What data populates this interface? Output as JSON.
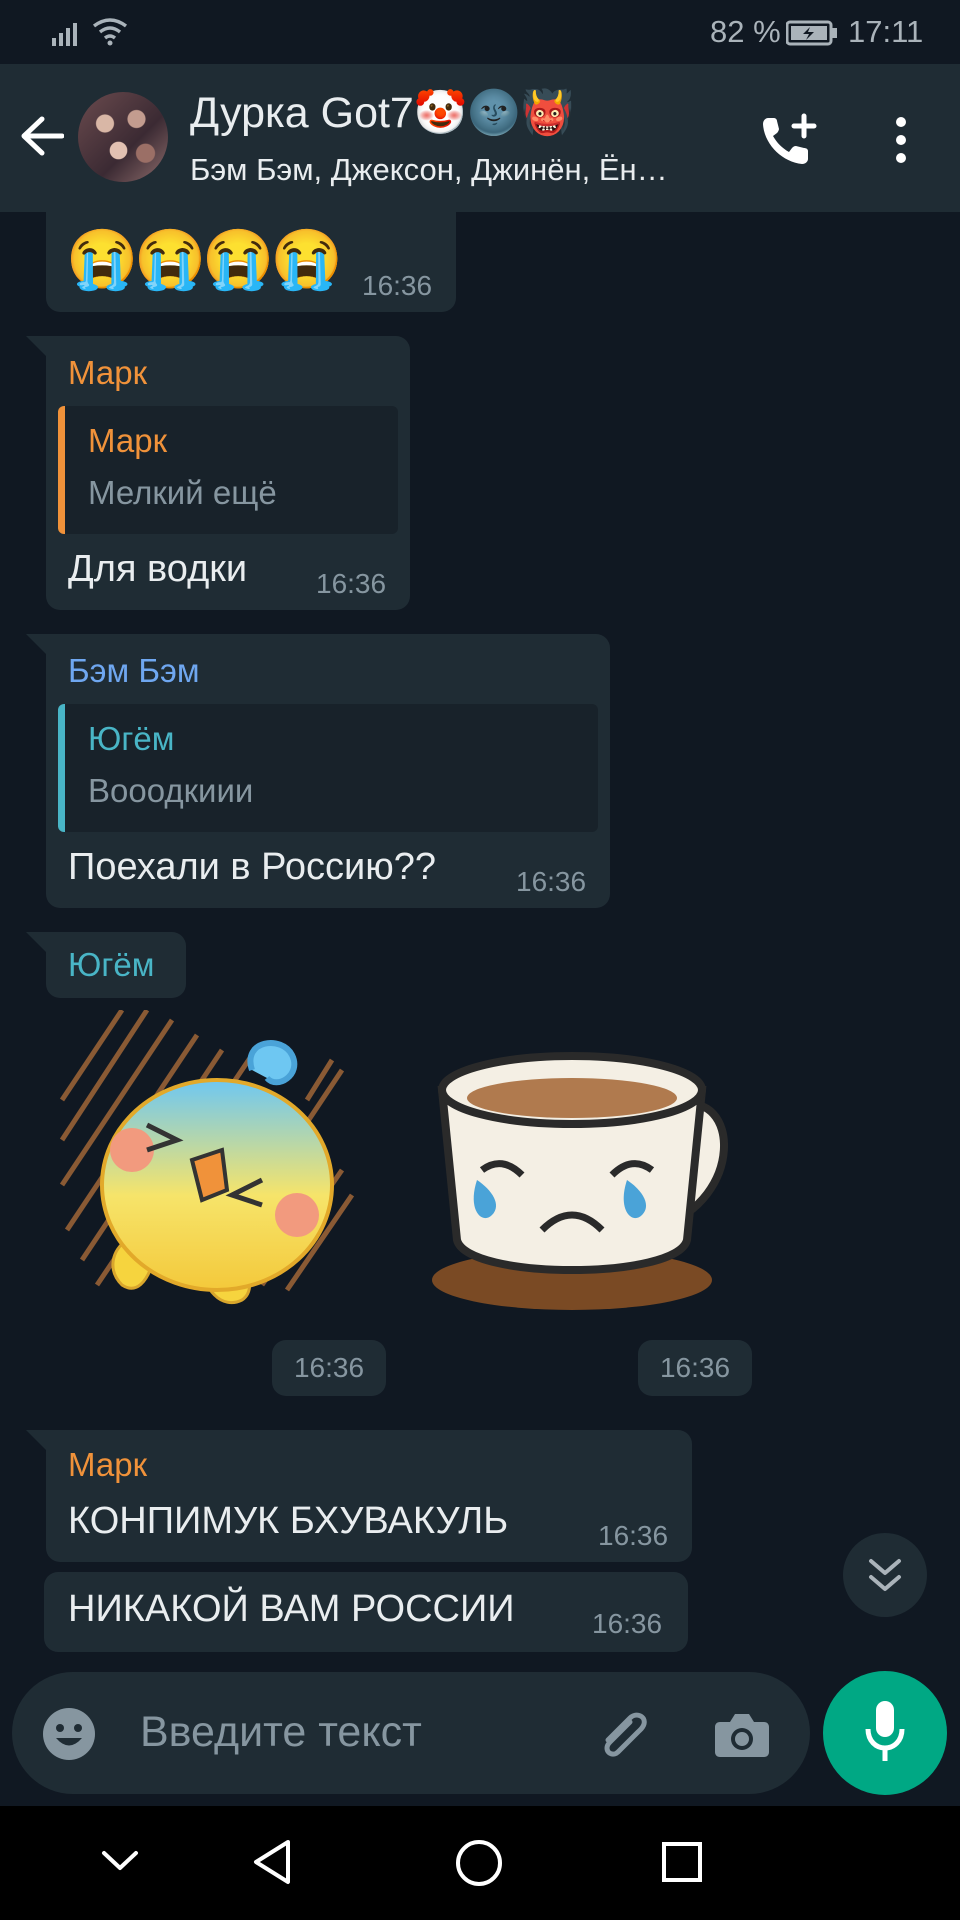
{
  "status_bar": {
    "battery": "82 %",
    "time": "17:11"
  },
  "header": {
    "title": "Дурка Got7🤡🌚👹",
    "subtitle": "Бэм Бэм, Джексон, Джинён, Ён…"
  },
  "colors": {
    "mark": "#f0923a",
    "bambam": "#6fa7f0",
    "yugyeom": "#49b5c6",
    "accent": "#00a884"
  },
  "messages": {
    "m0": {
      "emoji": "😭😭😭😭",
      "time": "16:36"
    },
    "m1": {
      "sender": "Марк",
      "reply_name": "Марк",
      "reply_text": "Мелкий ещё",
      "text": "Для водки",
      "time": "16:36"
    },
    "m2": {
      "sender": "Бэм Бэм",
      "reply_name": "Югём",
      "reply_text": "Вооодкиии",
      "text": "Поехали в Россию??",
      "time": "16:36"
    },
    "m3": {
      "sender": "Югём",
      "sticker1_time": "16:36",
      "sticker2_time": "16:36"
    },
    "m4": {
      "sender": "Марк",
      "text": "КОНПИМУК БХУВАКУЛЬ",
      "time": "16:36"
    },
    "m5": {
      "text": "НИКАКОЙ ВАМ РОССИИ",
      "time": "16:36"
    }
  },
  "input": {
    "placeholder": "Введите текст"
  }
}
